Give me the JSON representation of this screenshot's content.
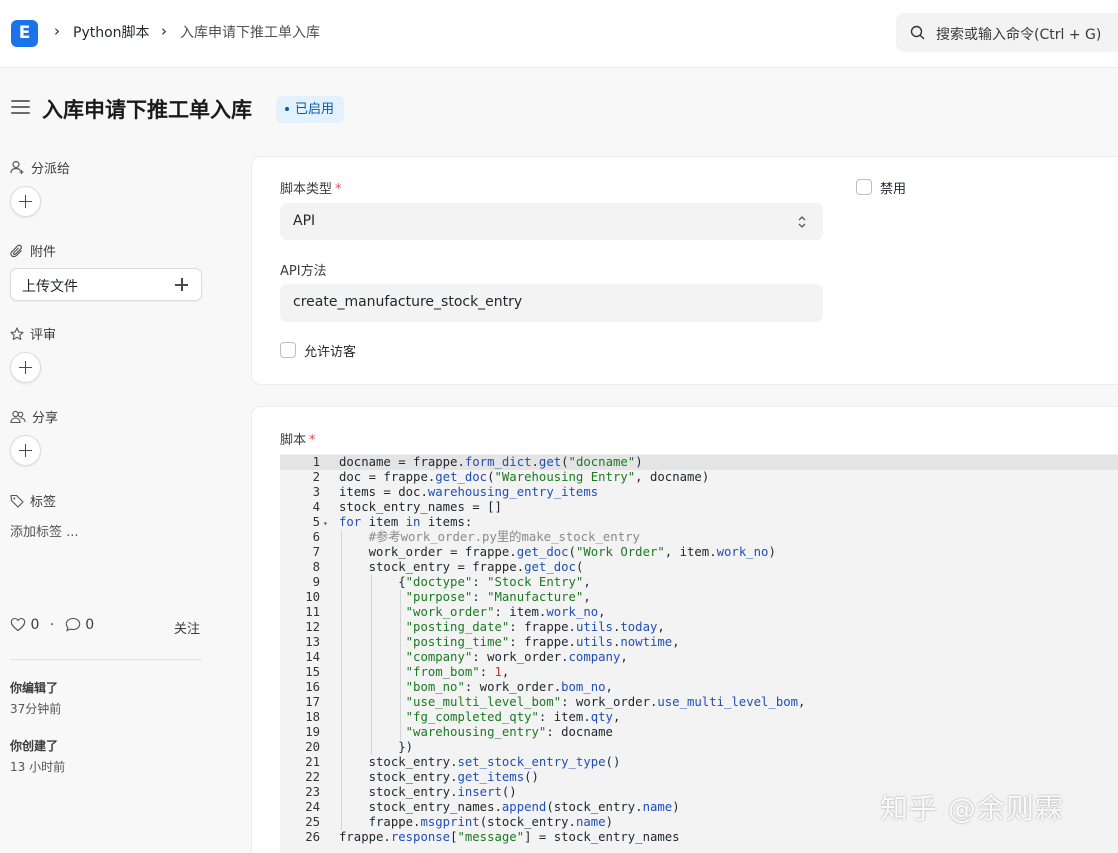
{
  "navbar": {
    "logo_letter": "E",
    "breadcrumbs": [
      "Python脚本",
      "入库申请下推工单入库"
    ],
    "search_placeholder": "搜索或输入命令(Ctrl + G)"
  },
  "page": {
    "title": "入库申请下推工单入库",
    "status_badge": "已启用"
  },
  "sidebar": {
    "assign_label": "分派给",
    "attachments_label": "附件",
    "upload_label": "上传文件",
    "review_label": "评审",
    "share_label": "分享",
    "tags_label": "标签",
    "add_tag_label": "添加标签 ...",
    "likes": "0",
    "comments": "0",
    "stats_sep": "·",
    "follow_label": "关注",
    "activity": [
      {
        "title": "你编辑了",
        "time": "37分钟前"
      },
      {
        "title": "你创建了",
        "time": "13 小时前"
      }
    ]
  },
  "form": {
    "script_type_label": "脚本类型",
    "required_mark": "*",
    "script_type_value": "API",
    "disabled_label": "禁用",
    "api_method_label": "API方法",
    "api_method_value": "create_manufacture_stock_entry",
    "allow_guest_label": "允许访客",
    "script_label": "脚本"
  },
  "code": {
    "lines": [
      "docname = frappe.form_dict.get(\"docname\")",
      "doc = frappe.get_doc(\"Warehousing Entry\", docname)",
      "items = doc.warehousing_entry_items",
      "stock_entry_names = []",
      "for item in items:",
      "    #参考work_order.py里的make_stock_entry",
      "    work_order = frappe.get_doc(\"Work Order\", item.work_no)",
      "    stock_entry = frappe.get_doc(",
      "        {\"doctype\": \"Stock Entry\",",
      "         \"purpose\": \"Manufacture\",",
      "         \"work_order\": item.work_no,",
      "         \"posting_date\": frappe.utils.today,",
      "         \"posting_time\": frappe.utils.nowtime,",
      "         \"company\": work_order.company,",
      "         \"from_bom\": 1,",
      "         \"bom_no\": work_order.bom_no,",
      "         \"use_multi_level_bom\": work_order.use_multi_level_bom,",
      "         \"fg_completed_qty\": item.qty,",
      "         \"warehousing_entry\": docname",
      "        })",
      "    stock_entry.set_stock_entry_type()",
      "    stock_entry.get_items()",
      "    stock_entry.insert()",
      "    stock_entry_names.append(stock_entry.name)",
      "    frappe.msgprint(stock_entry.name)",
      "frappe.response[\"message\"] = stock_entry_names"
    ],
    "fold_line": 5,
    "fold_marker": "▾"
  },
  "watermark": "知乎 @余则霖",
  "colors": {
    "brand": "#1a73e8",
    "badge_bg": "#e3f1fd",
    "badge_text": "#0c5aa6",
    "required": "#e24c4c",
    "string": "#1b7a21",
    "keyword": "#1f4fb8",
    "comment": "#8a8a8a",
    "number": "#c0392b"
  }
}
